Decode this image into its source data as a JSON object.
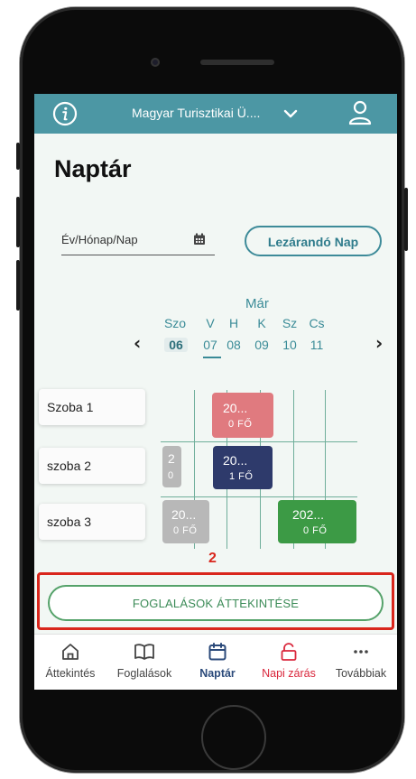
{
  "header": {
    "org_name": "Magyar Turisztikai Ü....",
    "info_icon": "info-circle-icon",
    "user_icon": "user-icon"
  },
  "page": {
    "title": "Naptár"
  },
  "date_filter": {
    "placeholder": "Év/Hónap/Nap",
    "icon": "calendar-icon"
  },
  "close_day_button": {
    "label": "Lezárandó Nap"
  },
  "calendar": {
    "month": "Már",
    "prev": "‹",
    "next": "›",
    "days": [
      {
        "abbr": "Szo",
        "num": "06"
      },
      {
        "abbr": "V",
        "num": "07"
      },
      {
        "abbr": "H",
        "num": "08"
      },
      {
        "abbr": "K",
        "num": "09"
      },
      {
        "abbr": "Sz",
        "num": "10"
      },
      {
        "abbr": "Cs",
        "num": "11"
      }
    ]
  },
  "rooms": [
    {
      "label": "Szoba 1"
    },
    {
      "label": "szoba 2"
    },
    {
      "label": "szoba 3"
    }
  ],
  "bookings": [
    {
      "line1": "20...",
      "line2": "0 FŐ",
      "color": "#e07a7f"
    },
    {
      "line1": "2",
      "line2": "0",
      "color": "#b8b8b8"
    },
    {
      "line1": "20...",
      "line2": "1 FŐ",
      "color": "#2e3a6b"
    },
    {
      "line1": "20...",
      "line2": "0 FŐ",
      "color": "#b8b8b8"
    },
    {
      "line1": "202...",
      "line2": "0 FŐ",
      "color": "#3c9a45"
    }
  ],
  "annotation": {
    "step": "2"
  },
  "overview_button": {
    "label": "FOGLALÁSOK ÁTTEKINTÉSE"
  },
  "tabs": [
    {
      "label": "Áttekintés",
      "icon": "home-icon"
    },
    {
      "label": "Foglalások",
      "icon": "book-icon"
    },
    {
      "label": "Naptár",
      "icon": "calendar-icon"
    },
    {
      "label": "Napi zárás",
      "icon": "lock-icon"
    },
    {
      "label": "Továbbiak",
      "icon": "more-icon"
    }
  ],
  "colors": {
    "header": "#4c97a4",
    "accent": "#3a8b97",
    "active_tab": "#2b4a7a",
    "danger": "#d9263b",
    "highlight": "#d9261c",
    "overview_border": "#55a26a"
  }
}
